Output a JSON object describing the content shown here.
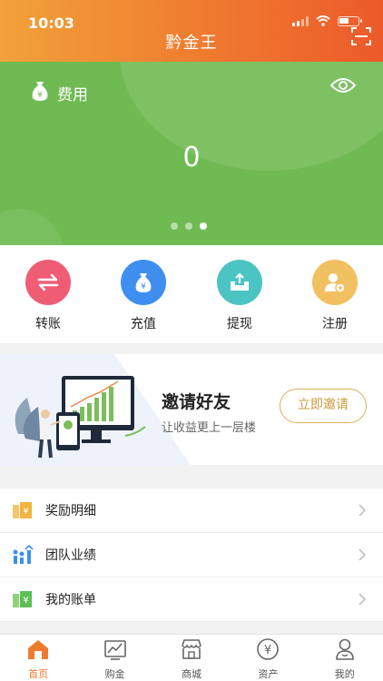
{
  "status_bar": {
    "time": "10:03"
  },
  "header": {
    "title": "黔金王"
  },
  "banner": {
    "label": "费用",
    "value": "0",
    "pages": 3,
    "active_page": 3,
    "color": "#6fba52"
  },
  "quick_actions": [
    {
      "label": "转账",
      "icon": "transfer-icon",
      "color": "#ef5d75"
    },
    {
      "label": "充值",
      "icon": "money-bag-icon",
      "color": "#3f8ff0"
    },
    {
      "label": "提现",
      "icon": "withdraw-icon",
      "color": "#4cc4c4"
    },
    {
      "label": "注册",
      "icon": "register-user-icon",
      "color": "#f1c061"
    }
  ],
  "invite": {
    "title": "邀请好友",
    "subtitle": "让收益更上一层楼",
    "button": "立即邀请"
  },
  "menu": [
    {
      "label": "奖励明细",
      "icon": "reward-icon"
    },
    {
      "label": "团队业绩",
      "icon": "team-performance-icon"
    },
    {
      "label": "我的账单",
      "icon": "bill-icon"
    }
  ],
  "tabbar": {
    "active": "首页",
    "tabs": [
      {
        "label": "首页",
        "icon": "home-icon"
      },
      {
        "label": "购金",
        "icon": "chart-icon"
      },
      {
        "label": "商城",
        "icon": "shop-icon"
      },
      {
        "label": "资产",
        "icon": "assets-yen-icon"
      },
      {
        "label": "我的",
        "icon": "profile-icon"
      }
    ]
  },
  "colors": {
    "header_start": "#f1a23a",
    "header_end": "#ec5a2a",
    "accent": "#ee7a2e",
    "gold": "#d8b05a"
  }
}
